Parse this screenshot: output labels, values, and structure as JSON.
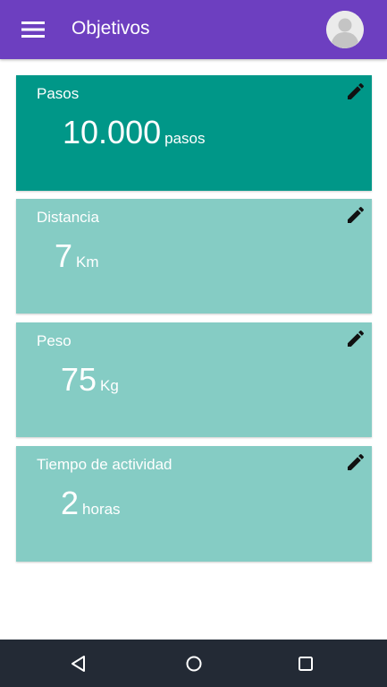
{
  "app_bar": {
    "title": "Objetivos",
    "background_color": "#6d3fc0",
    "menu_icon": "hamburger-menu-icon",
    "avatar_icon": "user-avatar-icon"
  },
  "goals": [
    {
      "label": "Pasos",
      "value": "10.000",
      "unit": "pasos",
      "selected": true,
      "color": "#009788"
    },
    {
      "label": "Distancia",
      "value": "7",
      "unit": "Km",
      "selected": false,
      "color": "#85ccc4"
    },
    {
      "label": "Peso",
      "value": "75",
      "unit": "Kg",
      "selected": false,
      "color": "#85ccc4"
    },
    {
      "label": "Tiempo de actividad",
      "value": "2",
      "unit": "horas",
      "selected": false,
      "color": "#85ccc4"
    }
  ],
  "card_edit_icon": "pencil-edit-icon",
  "system_nav": {
    "background_color": "#232a35",
    "buttons": [
      "back-triangle-icon",
      "home-circle-icon",
      "recents-square-icon"
    ]
  }
}
